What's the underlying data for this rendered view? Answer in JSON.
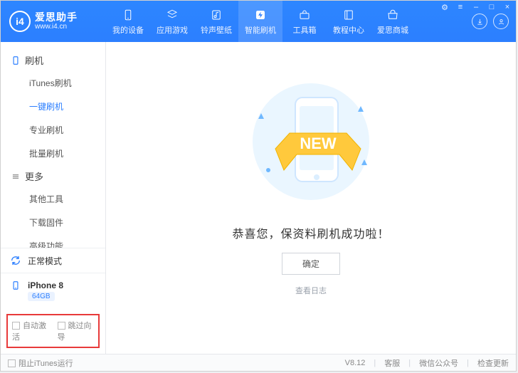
{
  "brand": {
    "logo_text": "i4",
    "title": "爱思助手",
    "subtitle": "www.i4.cn"
  },
  "nav": [
    {
      "label": "我的设备",
      "icon": "phone-icon"
    },
    {
      "label": "应用游戏",
      "icon": "apps-icon"
    },
    {
      "label": "铃声壁纸",
      "icon": "music-icon"
    },
    {
      "label": "智能刷机",
      "icon": "flash-icon",
      "active": true
    },
    {
      "label": "工具箱",
      "icon": "toolbox-icon"
    },
    {
      "label": "教程中心",
      "icon": "book-icon"
    },
    {
      "label": "爱思商城",
      "icon": "shop-icon"
    }
  ],
  "win_controls": {
    "settings": "⚙",
    "help": "≡",
    "min": "–",
    "max": "□",
    "close": "×"
  },
  "header_buttons": {
    "download": "download",
    "user": "user"
  },
  "sidebar": {
    "groups": [
      {
        "title": "刷机",
        "icon": "phone-outline-icon",
        "items": [
          {
            "label": "iTunes刷机"
          },
          {
            "label": "一键刷机",
            "active": true
          },
          {
            "label": "专业刷机"
          },
          {
            "label": "批量刷机"
          }
        ]
      },
      {
        "title": "更多",
        "icon": "more-icon",
        "items": [
          {
            "label": "其他工具"
          },
          {
            "label": "下载固件"
          },
          {
            "label": "高级功能"
          }
        ]
      }
    ],
    "mode": {
      "label": "正常模式"
    },
    "device": {
      "name": "iPhone 8",
      "storage": "64GB"
    },
    "options": {
      "auto_activate": "自动激活",
      "skip_guide": "跳过向导"
    }
  },
  "main": {
    "banner_text": "NEW",
    "message": "恭喜您，保资料刷机成功啦！",
    "ok_label": "确定",
    "log_label": "查看日志"
  },
  "status": {
    "block_itunes": "阻止iTunes运行",
    "version": "V8.12",
    "support": "客服",
    "wechat": "微信公众号",
    "update": "检查更新"
  }
}
